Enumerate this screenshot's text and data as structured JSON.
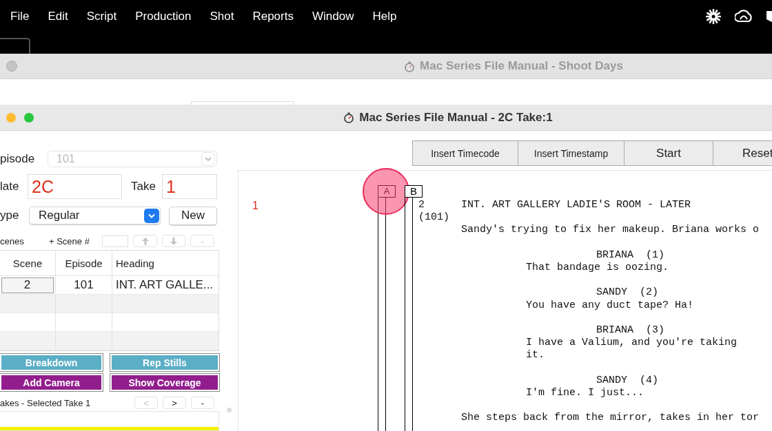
{
  "menu_bar": {
    "items": [
      "File",
      "Edit",
      "Script",
      "Production",
      "Shot",
      "Reports",
      "Window",
      "Help"
    ]
  },
  "back_window": {
    "title": "Mac Series File Manual - Shoot Days"
  },
  "window": {
    "title": "Mac Series File Manual - 2C Take:1"
  },
  "form": {
    "episode": {
      "label": "pisode",
      "value": "101",
      "disabled": true
    },
    "slate": {
      "label": "late",
      "value": "2C"
    },
    "take": {
      "label": "Take",
      "value": "1"
    },
    "type": {
      "label": "ype",
      "value": "Regular"
    },
    "new_button": "New"
  },
  "scenes": {
    "label": "cenes",
    "add_label": "+ Scene #",
    "buttons": [
      {
        "kind": "up",
        "disabled": true
      },
      {
        "kind": "down",
        "disabled": true
      },
      {
        "kind": "text",
        "label": "-",
        "disabled": true
      }
    ],
    "columns": [
      "Scene",
      "Episode",
      "Heading"
    ],
    "rows": [
      {
        "cells": [
          "2",
          "101",
          "INT. ART GALLE..."
        ]
      }
    ]
  },
  "action_buttons": [
    {
      "label": "Breakdown",
      "color": "#5aaec6"
    },
    {
      "label": "Rep Stills",
      "color": "#5aaec6"
    },
    {
      "label": "Add Camera",
      "color": "#921e8e"
    },
    {
      "label": "Show Coverage",
      "color": "#921e8e"
    }
  ],
  "takes": {
    "label": "akes - Selected Take  1",
    "buttons": [
      {
        "label": "<",
        "disabled": true
      },
      {
        "label": ">",
        "disabled": false
      },
      {
        "label": "-",
        "disabled": false
      }
    ]
  },
  "toolbar": {
    "buttons": [
      "Insert Timecode",
      "Insert Timestamp",
      "Start",
      "Reset"
    ]
  },
  "script": {
    "line_number": "1",
    "cameras": [
      {
        "label": "A",
        "clicked": true
      },
      {
        "label": "B",
        "clicked": false
      }
    ],
    "scene_number": "2",
    "episode": "(101)",
    "elements": [
      {
        "kind": "heading",
        "text": "INT. ART GALLERY LADIE'S ROOM - LATER"
      },
      {
        "kind": "action",
        "text": "Sandy's trying to fix her makeup. Briana works o"
      },
      {
        "kind": "character",
        "text": "BRIANA  (1)"
      },
      {
        "kind": "dialogue",
        "text": "That bandage is oozing."
      },
      {
        "kind": "character",
        "text": "SANDY  (2)"
      },
      {
        "kind": "dialogue",
        "text": "You have any duct tape? Ha!"
      },
      {
        "kind": "character",
        "text": "BRIANA  (3)"
      },
      {
        "kind": "dialogue",
        "text": "I have a Valium, and you're taking it."
      },
      {
        "kind": "character",
        "text": "SANDY  (4)"
      },
      {
        "kind": "dialogue",
        "text": "I'm fine. I just..."
      },
      {
        "kind": "action",
        "text": "She steps back from the mirror, takes in her tor"
      }
    ]
  }
}
